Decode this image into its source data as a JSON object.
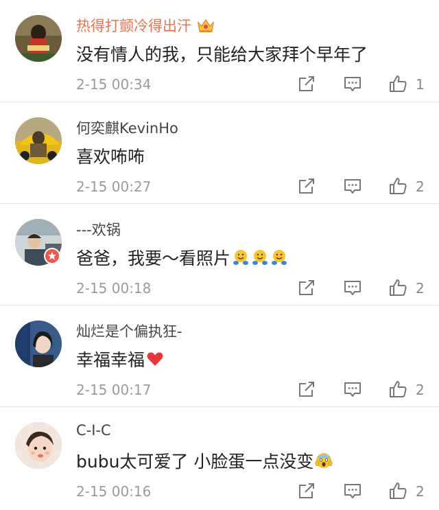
{
  "comments": [
    {
      "username": "热得打颤冷得出汗",
      "vip": true,
      "text": "没有情人的我，只能给大家拜个早年了",
      "time": "2-15 00:34",
      "likes": "1",
      "avatar": "avatar-dark-figure",
      "emoji": []
    },
    {
      "username": "何奕麒KevinHo",
      "vip": false,
      "text": "喜欢咘咘",
      "time": "2-15 00:27",
      "likes": "2",
      "avatar": "avatar-yellow-car",
      "emoji": []
    },
    {
      "username": "---欢锅",
      "vip": false,
      "text": "爸爸，我要～看照片",
      "time": "2-15 00:18",
      "likes": "2",
      "avatar": "avatar-person-car",
      "verified": true,
      "emoji": [
        "hugging-face-emoji",
        "hugging-face-emoji",
        "hugging-face-emoji"
      ]
    },
    {
      "username": "灿烂是个偏执狂-",
      "vip": false,
      "text": "幸福幸福",
      "time": "2-15 00:17",
      "likes": "2",
      "avatar": "avatar-girl",
      "emoji": [
        "red-heart-emoji"
      ]
    },
    {
      "username": "C-I-C",
      "vip": false,
      "text": "bubu太可爱了 小脸蛋一点没变",
      "time": "2-15 00:16",
      "likes": "2",
      "avatar": "avatar-baby",
      "emoji": [
        "screaming-face-emoji"
      ]
    }
  ],
  "icons": {
    "share": "share-icon",
    "reply": "comment-icon",
    "like": "thumbs-up-icon",
    "vip": "crown-icon"
  },
  "colors": {
    "vip_name": "#eb7350",
    "meta": "#9a9a9a",
    "divider": "#e6e6e6",
    "verified_badge": "#f1584d"
  }
}
